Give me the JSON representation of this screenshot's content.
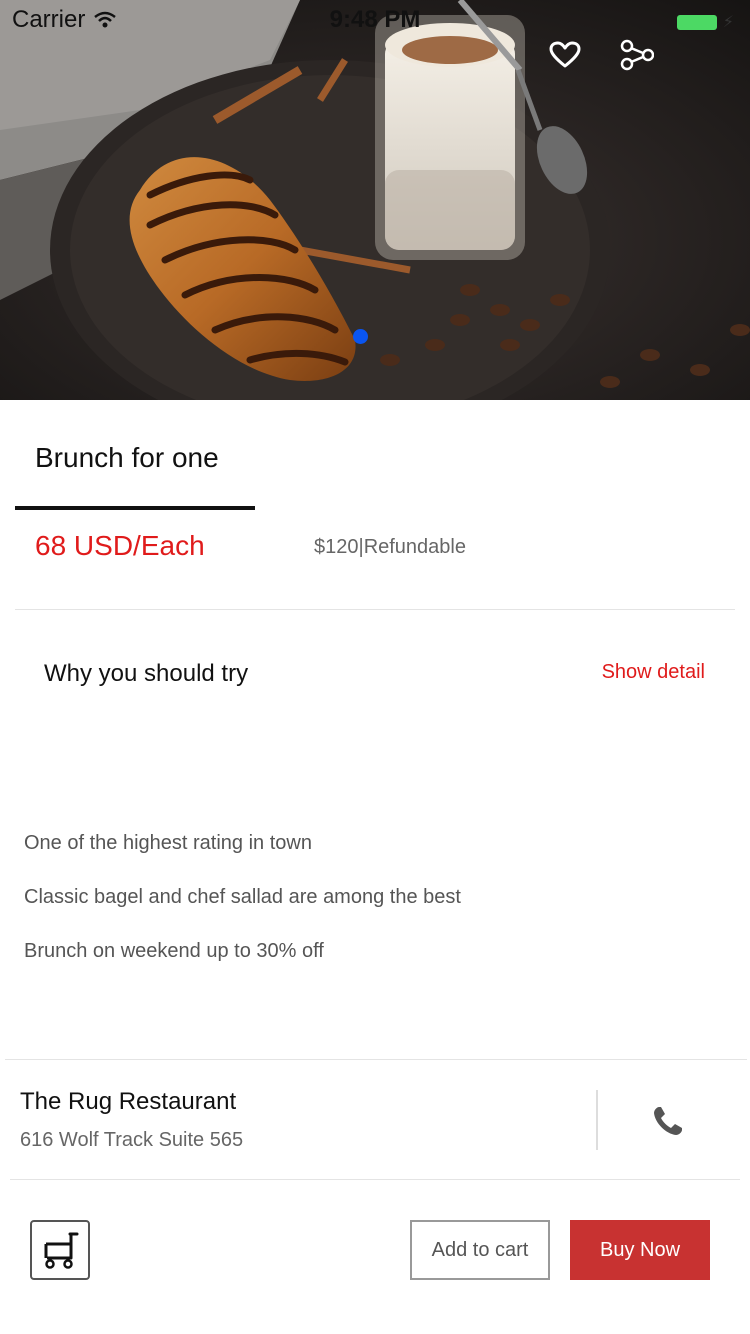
{
  "status_bar": {
    "carrier": "Carrier",
    "time": "9:48 PM"
  },
  "hero": {
    "image": "croissant-and-latte-photo",
    "carousel_active_index": 0,
    "actions": [
      {
        "icon": "heart-icon"
      },
      {
        "icon": "share-icon"
      }
    ]
  },
  "product": {
    "title": "Brunch for one",
    "price": "68 USD/Each",
    "original_price": "$120|Refundable"
  },
  "why": {
    "title": "Why you should try",
    "show_detail": "Show detail",
    "items": [
      "One of the highest rating in town",
      "Classic bagel and chef sallad are among the best",
      "Brunch on weekend up to 30% off"
    ]
  },
  "restaurant": {
    "name": "The Rug Restaurant",
    "address": "616 Wolf Track Suite 565",
    "phone_icon": "phone-icon"
  },
  "actions": {
    "cart_icon": "cart-icon",
    "add_to_cart": "Add to cart",
    "buy_now": "Buy Now"
  },
  "colors": {
    "accent_red": "#e01b1b",
    "buy_button": "#c83231",
    "carousel_dot": "#0a55f0",
    "battery": "#4cd964"
  }
}
